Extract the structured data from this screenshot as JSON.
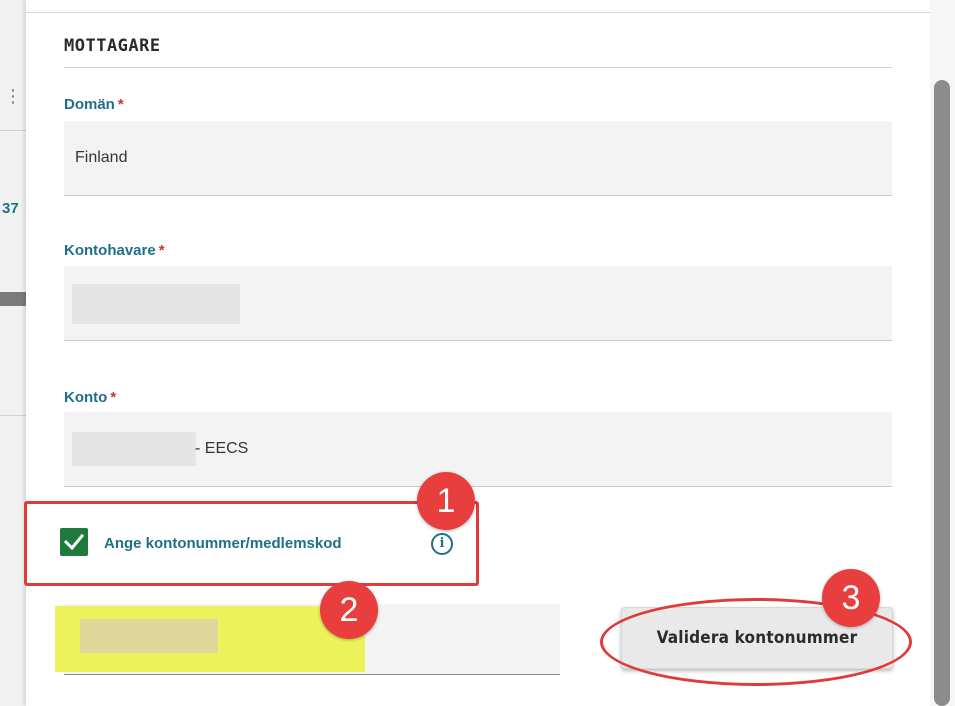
{
  "background_page": {
    "truncated_number": "37"
  },
  "section": {
    "title": "MOTTAGARE"
  },
  "fields": {
    "domain": {
      "label": "Domän",
      "required_mark": "*",
      "value": "Finland"
    },
    "account_holder": {
      "label": "Kontohavare",
      "required_mark": "*",
      "value": ""
    },
    "account": {
      "label": "Konto",
      "required_mark": "*",
      "suffix": "- EECS"
    }
  },
  "checkbox": {
    "label": "Ange kontonummer/medlemskod",
    "checked": true,
    "info_icon": "info-icon"
  },
  "validate_button": {
    "label": "Validera kontonummer"
  },
  "annotations": {
    "badge_1": "1",
    "badge_2": "2",
    "badge_3": "3"
  },
  "colors": {
    "label_teal": "#1f6f8a",
    "required_red": "#c0392b",
    "checkbox_green": "#1e7a3c",
    "annotation_red": "#e03a3a",
    "highlight_yellow": "#eef25a"
  }
}
